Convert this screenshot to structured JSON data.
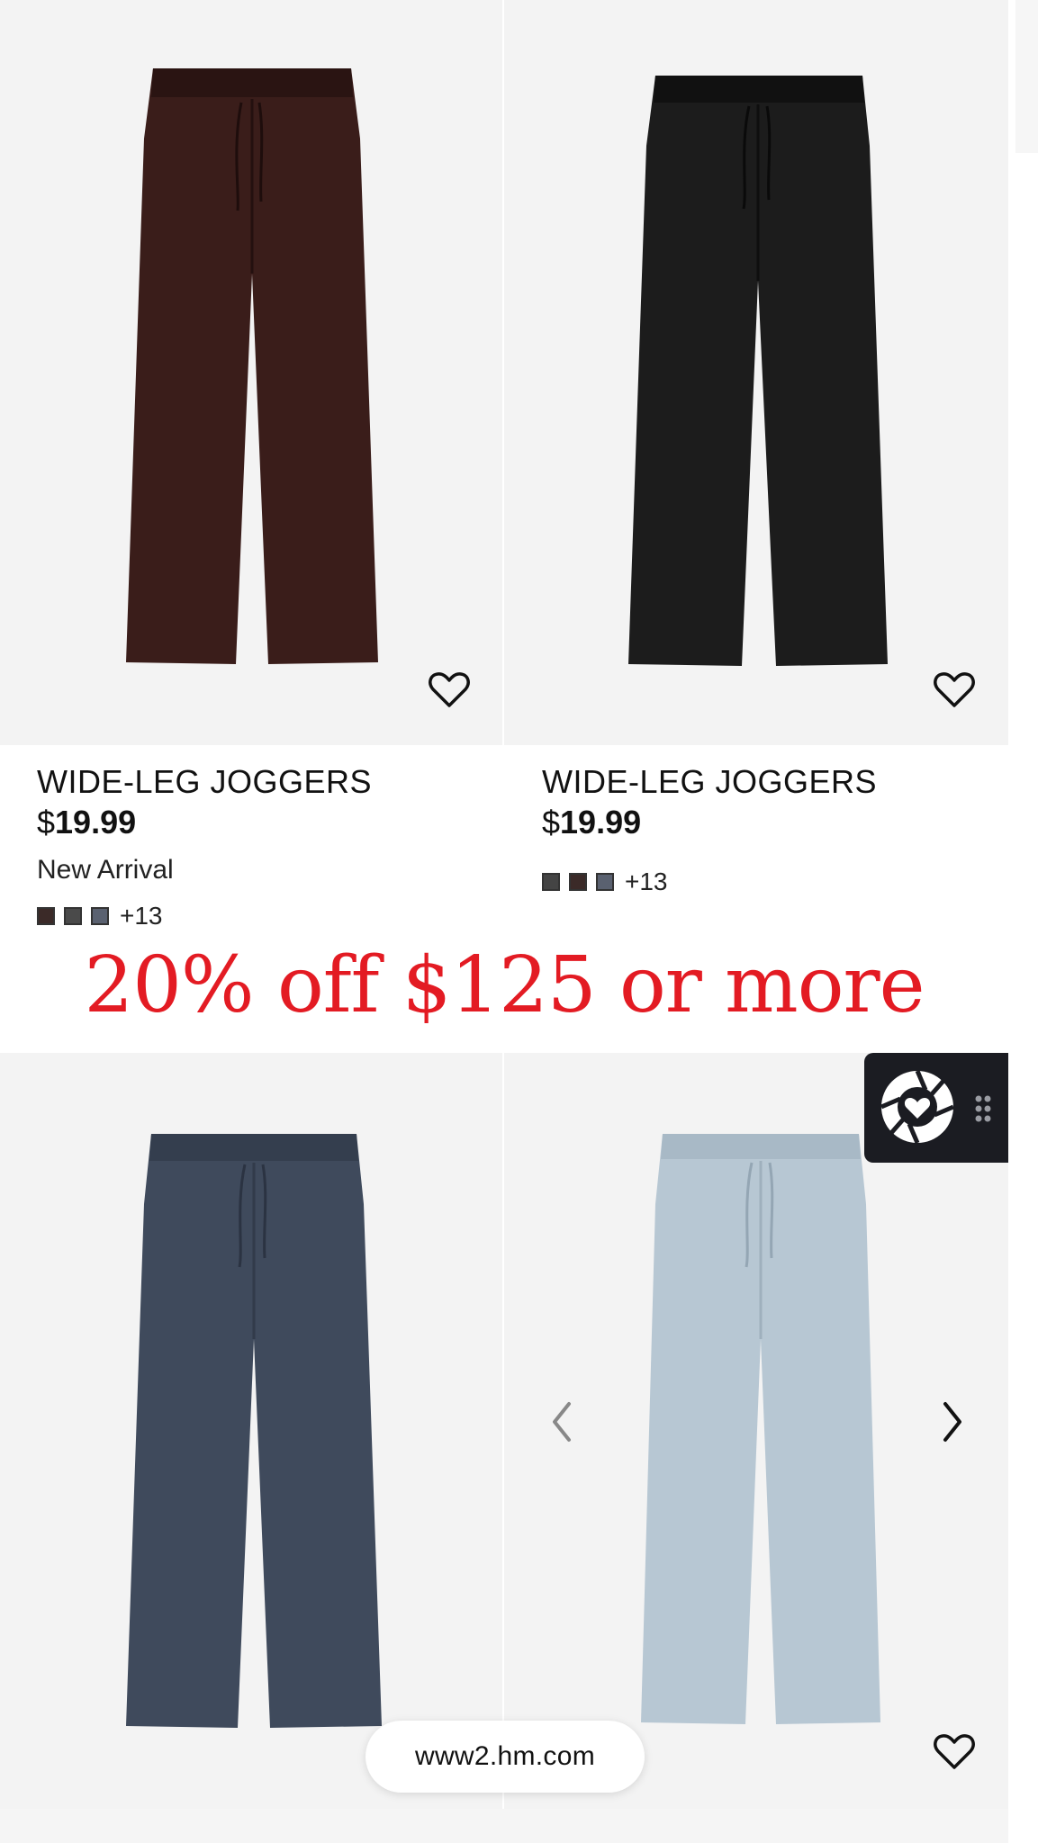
{
  "products": [
    {
      "name": "WIDE-LEG JOGGERS",
      "currency": "$",
      "price": "19.99",
      "tag": "New Arrival",
      "more_colors": "+13",
      "color": "#3a1d1a",
      "swatches": [
        "#3b2a28",
        "#4a4a4a",
        "#5a6170"
      ]
    },
    {
      "name": "WIDE-LEG JOGGERS",
      "currency": "$",
      "price": "19.99",
      "tag": "",
      "more_colors": "+13",
      "color": "#1c1c1c",
      "swatches": [
        "#444444",
        "#3b2a28",
        "#5a6170"
      ]
    },
    {
      "color": "#3f4a5c"
    },
    {
      "color": "#b7c7d3"
    }
  ],
  "promo": {
    "text": "20% off $125 or more",
    "color": "#e31b23"
  },
  "address_bar": {
    "url": "www2.hm.com"
  },
  "icons": {
    "favorite": "heart-outline-icon",
    "prev": "chevron-left-icon",
    "next": "chevron-right-icon",
    "assistant": "heart-aperture-logo-icon",
    "grip": "drag-handle-icon"
  }
}
